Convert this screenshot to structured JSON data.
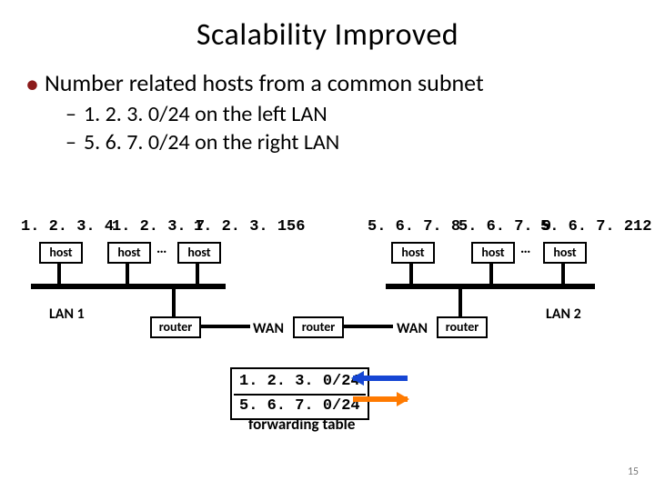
{
  "title": "Scalability Improved",
  "bullet": "Number related hosts from a common subnet",
  "sub1": "1. 2. 3. 0/24 on the left LAN",
  "sub2": "5. 6. 7. 0/24 on the right LAN",
  "left": {
    "ips": [
      "1. 2. 3. 4",
      "1. 2. 3. 7",
      "1. 2. 3. 156"
    ],
    "lan": "LAN 1"
  },
  "right": {
    "ips": [
      "5. 6. 7. 8",
      "5. 6. 7. 9",
      "5. 6. 7. 212"
    ],
    "lan": "LAN 2"
  },
  "labels": {
    "host": "host",
    "router": "router",
    "wan": "WAN",
    "ellipsis": "…",
    "fwd_table": "forwarding table"
  },
  "fwd": {
    "row1": "1. 2. 3. 0/24",
    "row2": "5. 6. 7. 0/24"
  },
  "colors": {
    "arrow_left": "#0a8a0a",
    "arrow_right": "#1646d4",
    "arrow_right2": "#ff7a00"
  },
  "page": "15"
}
